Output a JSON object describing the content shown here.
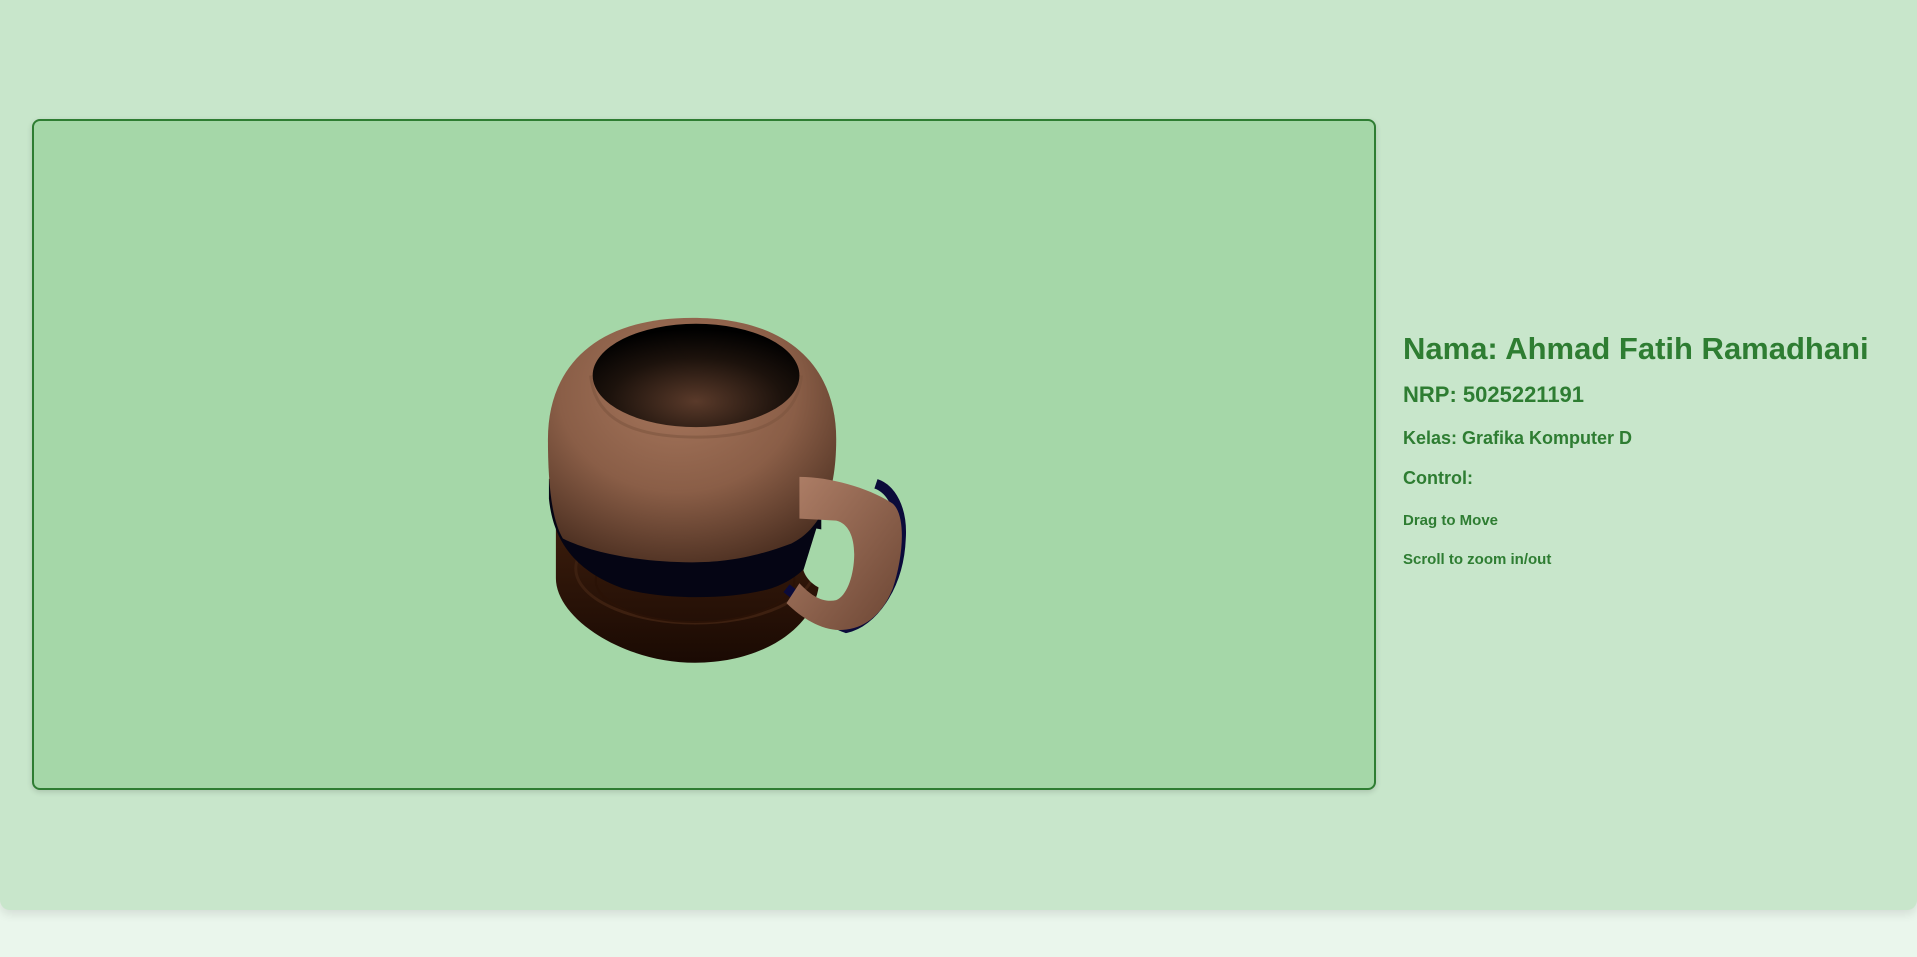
{
  "scene": {
    "object": "coffee-mug",
    "colors": {
      "panel_background": "#a5d7a8",
      "panel_border": "#2e7d32",
      "mug_body": "#9a6b52",
      "mug_inner": "#000000",
      "mug_band": "#050514",
      "saucer": "#2a1408"
    }
  },
  "info": {
    "name": "Nama: Ahmad Fatih Ramadhani",
    "nrp": "NRP: 5025221191",
    "kelas": "Kelas: Grafika Komputer D",
    "control_label": "Control:",
    "hint_drag": "Drag to Move",
    "hint_scroll": "Scroll to zoom in/out"
  },
  "theme": {
    "page_background": "#c8e6cb",
    "text_color": "#2e7d32"
  }
}
